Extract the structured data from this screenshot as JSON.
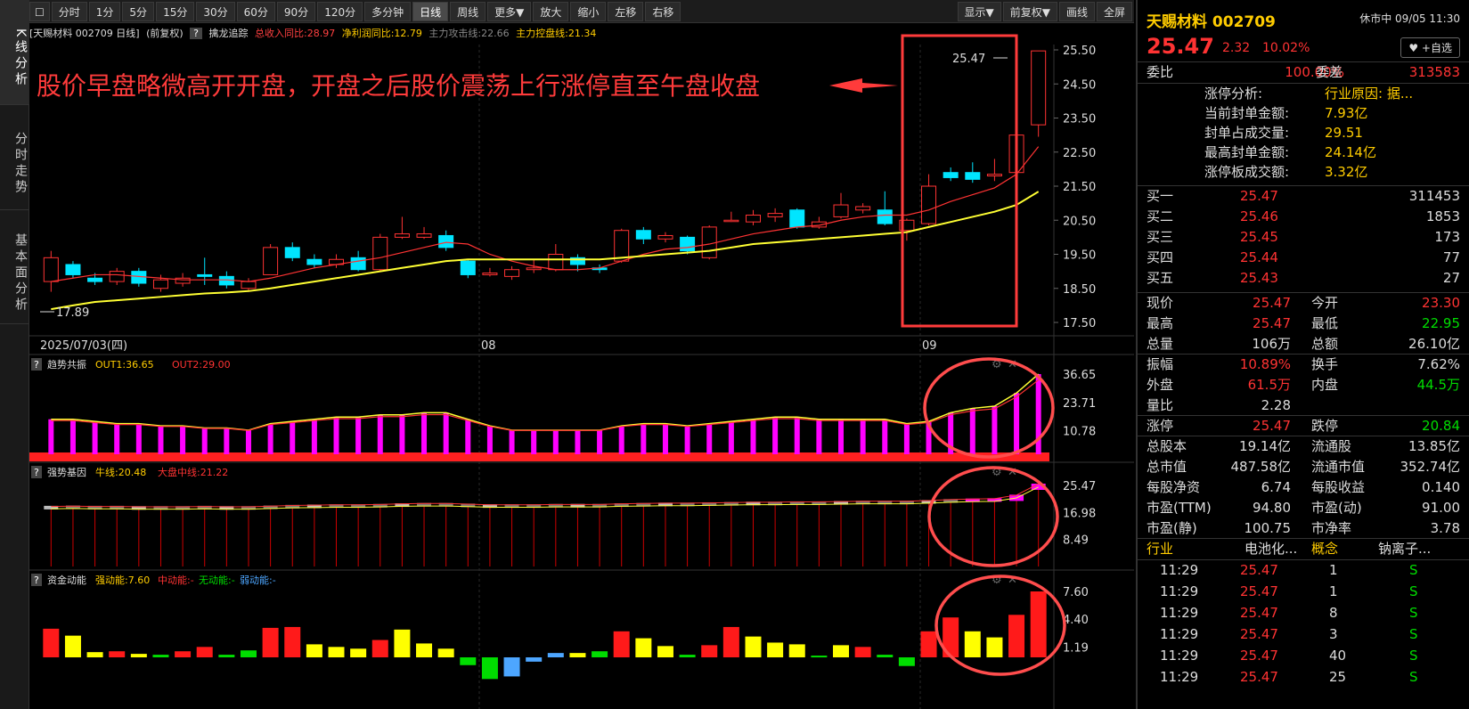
{
  "nav": [
    "K线分析",
    "分时走势",
    "基本面分析"
  ],
  "toolbar": {
    "left": [
      "分时",
      "1分",
      "5分",
      "15分",
      "30分",
      "60分",
      "90分",
      "120分",
      "多分钟",
      "日线",
      "周线",
      "更多▼",
      "放大",
      "缩小",
      "左移",
      "右移"
    ],
    "right": [
      "显示▼",
      "前复权▼",
      "画线",
      "全屏"
    ],
    "active": "日线"
  },
  "info": {
    "name": "[天赐材料 002709 日线]",
    "adj": "(前复权)",
    "q": "?",
    "strategy": "擒龙追踪",
    "rev": "总收入同比:28.97",
    "profit": "净利润同比:12.79",
    "attack": "主力攻击线:22.66",
    "control": "主力控盘线:21.34"
  },
  "annotation": "股价早盘略微高开开盘，开盘之后股价震荡上行涨停直至午盘收盘",
  "price_axis": [
    "25.50",
    "24.50",
    "23.50",
    "22.50",
    "21.50",
    "20.50",
    "19.50",
    "18.50",
    "17.50"
  ],
  "date_labels": [
    "2025/07/03(四)",
    "08",
    "09"
  ],
  "price_labels": {
    "high": "25.47",
    "low": "17.89"
  },
  "panels": [
    {
      "q": "?",
      "title": "趋势共振",
      "a": "OUT1:36.65",
      "b": "OUT2:29.00",
      "ticks": [
        "36.65",
        "23.71",
        "10.78"
      ]
    },
    {
      "q": "?",
      "title": "强势基因",
      "a": "牛线:20.48",
      "b": "大盘中线:21.22",
      "ticks": [
        "25.47",
        "16.98",
        "8.49"
      ]
    },
    {
      "q": "?",
      "title": "资金动能",
      "a": "强动能:7.60",
      "b": "中动能:-",
      "c": "无动能:-",
      "d": "弱动能:-",
      "ticks": [
        "7.60",
        "4.40",
        "1.19"
      ]
    }
  ],
  "stock": {
    "name": "天赐材料 002709",
    "status": "休市中 09/05 11:30",
    "price": "25.47",
    "change": "2.32",
    "pct": "10.02%",
    "fav": "♥ +自选"
  },
  "weibi": {
    "l1": "委比",
    "v1": "100.00%",
    "l2": "委差",
    "v2": "313583"
  },
  "limit_info": [
    [
      "涨停分析:",
      "行业原因: 据..."
    ],
    [
      "当前封单金额:",
      "7.93亿"
    ],
    [
      "封单占成交量:",
      "29.51"
    ],
    [
      "最高封单金额:",
      "24.14亿"
    ],
    [
      "涨停板成交额:",
      "3.32亿"
    ]
  ],
  "bids": [
    [
      "买一",
      "25.47",
      "311453"
    ],
    [
      "买二",
      "25.46",
      "1853"
    ],
    [
      "买三",
      "25.45",
      "173"
    ],
    [
      "买四",
      "25.44",
      "77"
    ],
    [
      "买五",
      "25.43",
      "27"
    ]
  ],
  "quote": [
    [
      "现价",
      "25.47",
      "今开",
      "23.30"
    ],
    [
      "最高",
      "25.47",
      "最低",
      "22.95"
    ],
    [
      "总量",
      "106万",
      "总额",
      "26.10亿"
    ],
    [
      "振幅",
      "10.89%",
      "换手",
      "7.62%"
    ],
    [
      "外盘",
      "61.5万",
      "内盘",
      "44.5万"
    ],
    [
      "量比",
      "2.28",
      "",
      ""
    ],
    [
      "涨停",
      "25.47",
      "跌停",
      "20.84"
    ],
    [
      "总股本",
      "19.14亿",
      "流通股",
      "13.85亿"
    ],
    [
      "总市值",
      "487.58亿",
      "流通市值",
      "352.74亿"
    ],
    [
      "每股净资",
      "6.74",
      "每股收益",
      "0.140"
    ],
    [
      "市盈(TTM)",
      "94.80",
      "市盈(动)",
      "91.00"
    ],
    [
      "市盈(静)",
      "100.75",
      "市净率",
      "3.78"
    ]
  ],
  "industry": {
    "l1": "行业",
    "v1": "电池化...",
    "l2": "概念",
    "v2": "钠离子..."
  },
  "ticks": [
    [
      "11:29",
      "25.47",
      "1",
      "S"
    ],
    [
      "11:29",
      "25.47",
      "1",
      "S"
    ],
    [
      "11:29",
      "25.47",
      "8",
      "S"
    ],
    [
      "11:29",
      "25.47",
      "3",
      "S"
    ],
    [
      "11:29",
      "25.47",
      "40",
      "S"
    ],
    [
      "11:29",
      "25.47",
      "25",
      "S"
    ]
  ],
  "colors": {
    "up": "#ff3333",
    "down": "#00e5ff",
    "ma1": "#ff3333",
    "ma2": "#ffff33",
    "box": "#ff3b3b",
    "volYellow": "#ffff00",
    "volGreen": "#00dd00",
    "volBlue": "#4da6ff",
    "bar": "#ff00ff"
  },
  "chart_data": {
    "type": "candlestick",
    "ylim": [
      17.5,
      25.5
    ],
    "candles": [
      {
        "o": 18.7,
        "c": 19.4,
        "h": 19.6,
        "l": 18.4
      },
      {
        "o": 19.2,
        "c": 18.9,
        "h": 19.3,
        "l": 18.8
      },
      {
        "o": 18.8,
        "c": 18.7,
        "h": 18.95,
        "l": 18.6
      },
      {
        "o": 18.7,
        "c": 19.0,
        "h": 19.1,
        "l": 18.6
      },
      {
        "o": 19.0,
        "c": 18.65,
        "h": 19.1,
        "l": 18.55
      },
      {
        "o": 18.5,
        "c": 18.75,
        "h": 18.9,
        "l": 18.4
      },
      {
        "o": 18.65,
        "c": 18.8,
        "h": 18.95,
        "l": 18.55
      },
      {
        "o": 18.9,
        "c": 18.85,
        "h": 19.4,
        "l": 18.6
      },
      {
        "o": 18.85,
        "c": 18.6,
        "h": 19.0,
        "l": 18.5
      },
      {
        "o": 18.5,
        "c": 18.7,
        "h": 18.8,
        "l": 18.4
      },
      {
        "o": 18.9,
        "c": 19.7,
        "h": 19.8,
        "l": 18.9
      },
      {
        "o": 19.7,
        "c": 19.4,
        "h": 19.85,
        "l": 19.3
      },
      {
        "o": 19.35,
        "c": 19.2,
        "h": 19.5,
        "l": 19.1
      },
      {
        "o": 19.2,
        "c": 19.35,
        "h": 19.5,
        "l": 19.1
      },
      {
        "o": 19.4,
        "c": 19.05,
        "h": 19.6,
        "l": 19.0
      },
      {
        "o": 19.05,
        "c": 20.0,
        "h": 20.1,
        "l": 19.0
      },
      {
        "o": 20.0,
        "c": 20.1,
        "h": 20.6,
        "l": 19.95
      },
      {
        "o": 20.0,
        "c": 20.1,
        "h": 20.3,
        "l": 19.95
      },
      {
        "o": 20.05,
        "c": 19.7,
        "h": 20.2,
        "l": 19.6
      },
      {
        "o": 19.3,
        "c": 18.9,
        "h": 19.35,
        "l": 18.8
      },
      {
        "o": 18.9,
        "c": 18.95,
        "h": 19.1,
        "l": 18.85
      },
      {
        "o": 18.85,
        "c": 19.05,
        "h": 19.15,
        "l": 18.75
      },
      {
        "o": 19.05,
        "c": 19.1,
        "h": 19.35,
        "l": 18.95
      },
      {
        "o": 19.05,
        "c": 19.5,
        "h": 19.8,
        "l": 19.0
      },
      {
        "o": 19.4,
        "c": 19.2,
        "h": 19.5,
        "l": 19.0
      },
      {
        "o": 19.1,
        "c": 19.05,
        "h": 19.2,
        "l": 18.95
      },
      {
        "o": 19.3,
        "c": 20.2,
        "h": 20.25,
        "l": 19.25
      },
      {
        "o": 20.2,
        "c": 19.95,
        "h": 20.3,
        "l": 19.8
      },
      {
        "o": 19.95,
        "c": 20.05,
        "h": 20.15,
        "l": 19.85
      },
      {
        "o": 20.0,
        "c": 19.6,
        "h": 20.05,
        "l": 19.5
      },
      {
        "o": 19.4,
        "c": 20.3,
        "h": 20.35,
        "l": 19.35
      },
      {
        "o": 20.5,
        "c": 20.5,
        "h": 20.75,
        "l": 20.45
      },
      {
        "o": 20.45,
        "c": 20.65,
        "h": 20.8,
        "l": 20.35
      },
      {
        "o": 20.6,
        "c": 20.7,
        "h": 20.85,
        "l": 20.45
      },
      {
        "o": 20.8,
        "c": 20.3,
        "h": 20.85,
        "l": 20.25
      },
      {
        "o": 20.3,
        "c": 20.45,
        "h": 20.6,
        "l": 20.25
      },
      {
        "o": 20.6,
        "c": 20.95,
        "h": 21.3,
        "l": 20.55
      },
      {
        "o": 20.8,
        "c": 20.9,
        "h": 21.0,
        "l": 20.7
      },
      {
        "o": 20.8,
        "c": 20.4,
        "h": 21.35,
        "l": 20.35
      },
      {
        "o": 20.2,
        "c": 20.5,
        "h": 20.55,
        "l": 19.9
      },
      {
        "o": 20.4,
        "c": 21.5,
        "h": 21.85,
        "l": 20.35
      },
      {
        "o": 21.9,
        "c": 21.75,
        "h": 22.05,
        "l": 21.65
      },
      {
        "o": 21.9,
        "c": 21.7,
        "h": 22.2,
        "l": 21.6
      },
      {
        "o": 21.8,
        "c": 21.85,
        "h": 22.3,
        "l": 21.65
      },
      {
        "o": 21.9,
        "c": 23.0,
        "h": 23.55,
        "l": 21.85
      },
      {
        "o": 23.3,
        "c": 25.47,
        "h": 25.47,
        "l": 22.95
      }
    ],
    "ma_short": [
      18.7,
      18.8,
      18.9,
      18.9,
      18.85,
      18.8,
      18.75,
      18.75,
      18.75,
      18.7,
      18.8,
      18.95,
      19.1,
      19.2,
      19.3,
      19.4,
      19.55,
      19.7,
      19.85,
      19.8,
      19.5,
      19.3,
      19.15,
      19.05,
      19.05,
      19.1,
      19.3,
      19.5,
      19.65,
      19.7,
      19.8,
      19.95,
      20.1,
      20.2,
      20.3,
      20.35,
      20.5,
      20.6,
      20.65,
      20.65,
      20.8,
      21.05,
      21.25,
      21.45,
      21.85,
      22.66
    ],
    "ma_long": [
      17.89,
      18.0,
      18.1,
      18.15,
      18.2,
      18.25,
      18.3,
      18.35,
      18.38,
      18.42,
      18.5,
      18.6,
      18.7,
      18.8,
      18.9,
      19.0,
      19.1,
      19.2,
      19.3,
      19.35,
      19.35,
      19.35,
      19.35,
      19.35,
      19.35,
      19.35,
      19.4,
      19.45,
      19.5,
      19.55,
      19.6,
      19.7,
      19.8,
      19.85,
      19.9,
      19.95,
      20.0,
      20.05,
      20.1,
      20.15,
      20.3,
      20.45,
      20.6,
      20.75,
      20.95,
      21.34
    ]
  },
  "ind1": {
    "bars": [
      16,
      16,
      15,
      14,
      14,
      13,
      13,
      12,
      12,
      11,
      14,
      15,
      16,
      17,
      17,
      18,
      18,
      19,
      19,
      16,
      13,
      11,
      11,
      11,
      11,
      11,
      13,
      14,
      14,
      13,
      14,
      15,
      16,
      17,
      17,
      16,
      16,
      16,
      16,
      14,
      15,
      19,
      21,
      22,
      28,
      36.65
    ],
    "ymax": 36.65
  },
  "ind2": {
    "bars": [
      18.5,
      18.6,
      18.5,
      18.5,
      18.4,
      18.4,
      18.4,
      18.5,
      18.4,
      18.4,
      18.6,
      18.8,
      18.9,
      19.0,
      19.0,
      19.1,
      19.3,
      19.4,
      19.4,
      19.2,
      19.0,
      19.0,
      19.0,
      19.1,
      19.1,
      19.1,
      19.3,
      19.4,
      19.5,
      19.5,
      19.6,
      19.7,
      19.8,
      19.8,
      19.9,
      19.9,
      20.0,
      20.1,
      20.1,
      20.1,
      20.3,
      20.6,
      20.8,
      20.9,
      22.0,
      25.47
    ],
    "ymax": 25.47
  },
  "ind3": {
    "vals": [
      3.3,
      2.5,
      0.6,
      0.7,
      0.4,
      0.3,
      0.7,
      1.2,
      0.3,
      0.8,
      3.4,
      3.5,
      1.5,
      1.2,
      1.0,
      2.0,
      3.2,
      1.6,
      1.0,
      -0.9,
      -2.5,
      -2.2,
      -0.5,
      0.5,
      0.5,
      0.7,
      3.0,
      2.2,
      1.3,
      0.3,
      1.4,
      3.5,
      2.4,
      1.7,
      1.5,
      0.2,
      1.4,
      1.2,
      0.3,
      -1.0,
      3.0,
      4.6,
      3.0,
      2.3,
      4.9,
      7.6
    ],
    "colors": [
      "r",
      "y",
      "y",
      "r",
      "y",
      "g",
      "r",
      "r",
      "g",
      "g",
      "r",
      "r",
      "y",
      "y",
      "y",
      "r",
      "y",
      "y",
      "y",
      "g",
      "g",
      "b",
      "b",
      "b",
      "y",
      "g",
      "r",
      "y",
      "y",
      "g",
      "r",
      "r",
      "y",
      "y",
      "y",
      "g",
      "y",
      "r",
      "g",
      "g",
      "r",
      "r",
      "y",
      "y",
      "r",
      "r"
    ],
    "ymax": 7.6
  }
}
